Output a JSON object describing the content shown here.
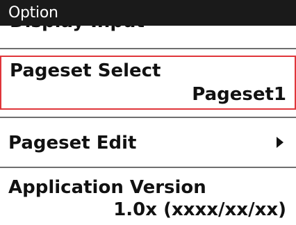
{
  "title_bar": {
    "title": "Option"
  },
  "menu": {
    "previous_item_partial": "Display Input",
    "pageset_select": {
      "label": "Pageset Select",
      "value": "Pageset1"
    },
    "pageset_edit": {
      "label": "Pageset Edit",
      "icon": "chevron-right-icon"
    },
    "application_version": {
      "label": "Application Version",
      "value": "1.0x (xxxx/xx/xx)"
    }
  },
  "colors": {
    "title_bar_bg": "#1a1a1a",
    "selection_border": "#e0353a",
    "divider": "#6f6f6f"
  }
}
